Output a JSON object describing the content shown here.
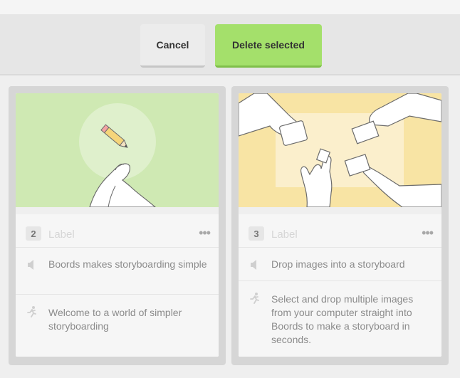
{
  "toolbar": {
    "cancel_label": "Cancel",
    "delete_label": "Delete selected"
  },
  "cards": [
    {
      "number": "2",
      "label_placeholder": "Label",
      "menu_glyph": "•••",
      "dialogue": "Boords makes storyboarding simple",
      "action": "Welcome to a world of simpler storyboarding",
      "thumb_color": "#cfe9b3"
    },
    {
      "number": "3",
      "label_placeholder": "Label",
      "menu_glyph": "•••",
      "dialogue": "Drop images into a storyboard",
      "action": "Select and drop multiple images from your computer straight into Boords to make a storyboard in seconds.",
      "thumb_color": "#f8e4a4"
    }
  ],
  "colors": {
    "primary_button": "#a4e06b",
    "secondary_button": "#ececec"
  }
}
